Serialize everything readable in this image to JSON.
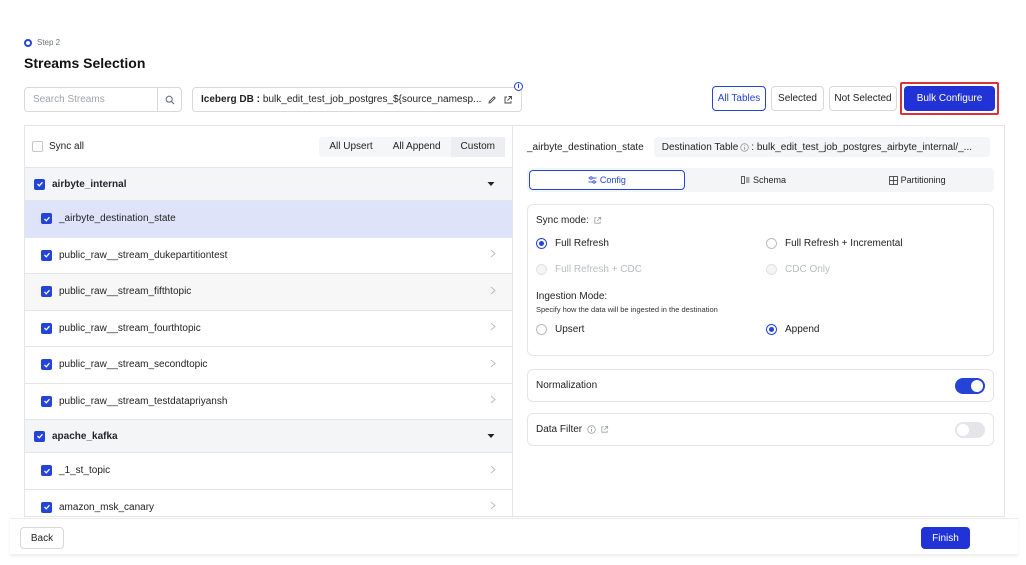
{
  "header": {
    "step": "Step 2",
    "title": "Streams Selection"
  },
  "toolbar": {
    "search_placeholder": "Search Streams",
    "iceberg_label": "Iceberg DB :",
    "iceberg_value": "bulk_edit_test_job_postgres_${source_namesp...",
    "info_badge": "i",
    "filters": [
      "All Tables",
      "Selected",
      "Not Selected"
    ],
    "active_filter": "All Tables",
    "bulk_configure": "Bulk Configure"
  },
  "left_panel": {
    "sync_all": "Sync all",
    "modes": [
      "All Upsert",
      "All Append",
      "Custom"
    ],
    "active_mode": "Custom",
    "namespaces": [
      {
        "name": "airbyte_internal",
        "streams": [
          "_airbyte_destination_state",
          "public_raw__stream_dukepartitiontest",
          "public_raw__stream_fifthtopic",
          "public_raw__stream_fourthtopic",
          "public_raw__stream_secondtopic",
          "public_raw__stream_testdatapriyansh"
        ]
      },
      {
        "name": "apache_kafka",
        "streams": [
          "_1_st_topic",
          "amazon_msk_canary"
        ]
      }
    ],
    "selected_stream": "_airbyte_destination_state"
  },
  "right_panel": {
    "stream_name": "_airbyte_destination_state",
    "dest_label": "Destination Table",
    "dest_value": ": bulk_edit_test_job_postgres_airbyte_internal/_...",
    "tabs": [
      "Config",
      "Schema",
      "Partitioning"
    ],
    "active_tab": "Config",
    "sync_mode_label": "Sync mode:",
    "sync_modes": [
      {
        "label": "Full Refresh",
        "state": "selected"
      },
      {
        "label": "Full Refresh + Incremental",
        "state": "enabled"
      },
      {
        "label": "Full Refresh + CDC",
        "state": "disabled"
      },
      {
        "label": "CDC Only",
        "state": "disabled"
      }
    ],
    "ingestion_label": "Ingestion Mode:",
    "ingestion_desc": "Specify how the data will be ingested in the destination",
    "ingestion_modes": [
      {
        "label": "Upsert",
        "state": "enabled"
      },
      {
        "label": "Append",
        "state": "selected"
      }
    ],
    "normalization_label": "Normalization",
    "normalization_on": true,
    "data_filter_label": "Data Filter",
    "data_filter_on": false
  },
  "footer": {
    "back": "Back",
    "finish": "Finish"
  },
  "colors": {
    "primary": "#2133d6",
    "accent": "#2444d8",
    "highlight_box": "#d8323a",
    "selected_row": "#dfe3fa"
  }
}
